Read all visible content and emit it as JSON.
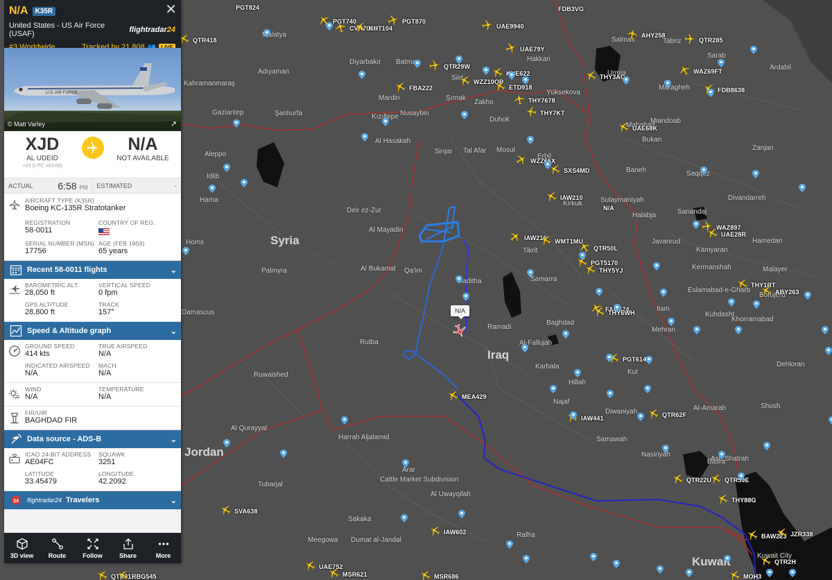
{
  "panel": {
    "callsign": "N/A",
    "type_code": "K35R",
    "operator": "United States - US Air Force (USAF)",
    "brand": "flightradar24",
    "rank": "#3 Worldwide",
    "tracked_by": "Tracked by 21,808",
    "live": "LIVE",
    "photo_credit": "© Matt Varley",
    "origin_code": "XJD",
    "origin_name": "AL UDEID",
    "origin_tz": "+03 (UTC +03:00)",
    "dest_code": "N/A",
    "dest_name": "NOT AVAILABLE",
    "actual_label": "ACTUAL",
    "actual_time": "6:58",
    "actual_ampm": "PM",
    "estimated_label": "ESTIMATED",
    "estimated_value": "-",
    "aircraft_type_label": "AIRCRAFT TYPE (K35R)",
    "aircraft_type": "Boeing KC-135R Stratotanker",
    "registration_label": "REGISTRATION",
    "registration": "58-0011",
    "country_label": "COUNTRY OF REG.",
    "serial_label": "SERIAL NUMBER (MSN)",
    "serial": "17756",
    "age_label": "AGE (Feb 1959)",
    "age": "65 years",
    "recent_flights": "Recent 58-0011 flights",
    "baro_label": "BAROMETRIC ALT.",
    "baro": "28,050 ft",
    "vspeed_label": "VERTICAL SPEED",
    "vspeed": "0 fpm",
    "gps_label": "GPS ALTITUDE",
    "gps": "28,800 ft",
    "track_label": "TRACK",
    "track": "157°",
    "speed_graph": "Speed & Altitude graph",
    "gs_label": "GROUND SPEED",
    "gs": "414 kts",
    "tas_label": "TRUE AIRSPEED",
    "tas": "N/A",
    "ias_label": "INDICATED AIRSPEED",
    "ias": "N/A",
    "mach_label": "MACH",
    "mach": "N/A",
    "wind_label": "WIND",
    "wind": "N/A",
    "temp_label": "TEMPERATURE",
    "temp": "N/A",
    "fir_label": "FIR/UIR",
    "fir": "BAGHDAD FIR",
    "data_source": "Data source - ADS-B",
    "icao_label": "ICAO 24-BIT ADDRESS",
    "icao": "AE04FC",
    "squawk_label": "SQUAWK",
    "squawk": "3251",
    "lat_label": "LATITUDE",
    "lat": "33.45479",
    "lon_label": "LONGITUDE",
    "lon": "42.2092",
    "travelers_brand": "flightradar24",
    "travelers": "Travelers",
    "buttons": [
      "3D view",
      "Route",
      "Follow",
      "Share",
      "More"
    ]
  },
  "map": {
    "selected_label": "N/A",
    "countries": [
      "Syria",
      "Iraq",
      "Jordan",
      "Kuwait"
    ],
    "cities": [
      "Malatya",
      "Adıyaman",
      "Kahramanmaraş",
      "Gaziantep",
      "Şanlıurfa",
      "Aleppo",
      "Idlib",
      "Hama",
      "Homs",
      "Damascus",
      "Diyarbakır",
      "Batman",
      "Mardin",
      "Kızıltepe",
      "Nusaybin",
      "Siirt",
      "Şırnak",
      "Zakho",
      "Duhok",
      "Al Hasakah",
      "Sinjar",
      "Tal Afar",
      "Mosul",
      "Erbil",
      "Kirkuk",
      "Sulaymaniyah",
      "Halabja",
      "Baneh",
      "Bukan",
      "Mahabad",
      "Miandoab",
      "Salmas",
      "Tabriz",
      "Urmia",
      "Maragheh",
      "Sarab",
      "Ardabil",
      "Zanjan",
      "Yüksekova",
      "Hakkari",
      "Deir ez-Zur",
      "Al Mayadin",
      "Al Bukamal",
      "Qa'im",
      "Haditha",
      "Palmyra",
      "Ramadi",
      "Al-Fallujah",
      "Baghdad",
      "Tikrit",
      "Samarra",
      "Karbala",
      "Hillah",
      "Najaf",
      "Kut",
      "Diwaniyah",
      "Samawah",
      "Nasiriyah",
      "Al-Amarah",
      "Basra",
      "Rutba",
      "Ruwaished",
      "Al Qurayyat",
      "Tubarjal",
      "Harrah Aljalamid",
      "Cattle Market Subdivision",
      "Al Uwayqilah",
      "Arar",
      "Sakaka",
      "Dumat al-Jandal",
      "Meegowa",
      "Rafha",
      "Kuwait City",
      "Ilam",
      "Kermanshah",
      "Eslamabad-e-Gharb",
      "Sanandaj",
      "Javanrud",
      "Kamyaran",
      "Hamedan",
      "Malayer",
      "Borujerd",
      "Khorramabad",
      "Kuhdasht",
      "Shush",
      "Ash Shatrah",
      "Mehran",
      "Dehloran",
      "Saqqez",
      "Divandarreh"
    ],
    "flight_labels": [
      "PGT740",
      "CVR7085",
      "KHT104",
      "PGT870",
      "UAE9940",
      "AHY258",
      "QTR285",
      "QTR418",
      "UAE79Y",
      "THY3AC",
      "WAZ69FT",
      "FDB8638",
      "QTR29W",
      "KNE622",
      "WZZ10QP",
      "ETD918",
      "FBA222",
      "THY7678",
      "THY7KT",
      "UAE68K",
      "WZZ66X",
      "SXS4MD",
      "IAW210",
      "N/A",
      "IAW216",
      "WMT1MU",
      "QTR50L",
      "PGT5170",
      "THY5YJ",
      "WAZ897",
      "UAE28R",
      "FADS74",
      "THY6WH",
      "THY1RT",
      "ABY263",
      "PGT614",
      "MEA429",
      "IAW441",
      "QTR62F",
      "QTR22U",
      "QTR59E",
      "THY88G",
      "SVA638",
      "IAW602",
      "UAE752",
      "MSR621",
      "MSR686",
      "BAW223",
      "JZR338",
      "QTR2H",
      "MOH3",
      "QTR31",
      "RBG545",
      "FDB3VG",
      "PGT824"
    ]
  }
}
